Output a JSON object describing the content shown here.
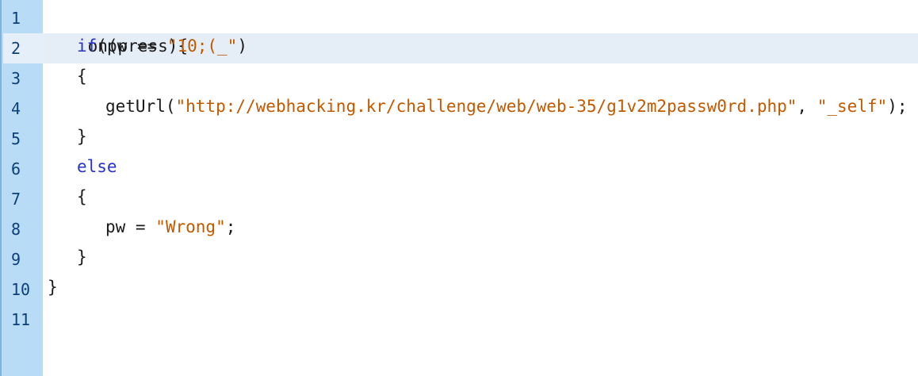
{
  "gutter": {
    "line_numbers": [
      "1",
      "2",
      "3",
      "4",
      "5",
      "6",
      "7",
      "8",
      "9",
      "10",
      "11"
    ],
    "current_line": 2
  },
  "code": {
    "line1": {
      "text": "on(press){"
    },
    "line2": {
      "kw": "if",
      "open": "(pw == ",
      "str": "\"10;(_\"",
      "close": ")"
    },
    "line3": {
      "text": "{"
    },
    "line4": {
      "fn": "getUrl(",
      "str1": "\"http://webhacking.kr/challenge/web/web-35/g1v2m2passw0rd.php\"",
      "sep": ", ",
      "str2": "\"_self\"",
      "end": ");"
    },
    "line5": {
      "text": "}"
    },
    "line6": {
      "kw": "else"
    },
    "line7": {
      "text": "{"
    },
    "line8": {
      "lhs": "pw = ",
      "str": "\"Wrong\"",
      "end": ";"
    },
    "line9": {
      "text": "}"
    },
    "line10": {
      "text": "}"
    },
    "line11": {
      "text": ""
    }
  },
  "colors": {
    "gutter_bg": "#b8dbf6",
    "gutter_text": "#0d3f78",
    "current_line_bg": "#e5eef7",
    "keyword": "#2632c8",
    "string": "#c05a00",
    "text": "#1a1a1a"
  }
}
